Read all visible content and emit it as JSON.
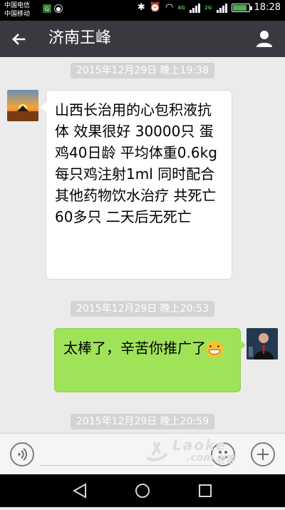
{
  "status": {
    "carrier1": "中国电信",
    "carrier2": "中国移动",
    "net1": "4G",
    "net2": "2G",
    "time": "18:28"
  },
  "appbar": {
    "title": "济南王峰"
  },
  "messages": [
    {
      "timestamp": "2015年12月29日 晚上19:38",
      "sender": "left",
      "text": "山西长治用的心包积液抗体 效果很好 30000只 蛋鸡40日龄 平均体重0.6kg 每只鸡注射1ml 同时配合其他药物饮水治疗 共死亡60多只 二天后无死亡"
    },
    {
      "timestamp": "2015年12月29日 晚上20:53",
      "sender": "right",
      "text": "太棒了，辛苦你推广了"
    },
    {
      "timestamp": "2015年12月29日 晚上20:59"
    }
  ],
  "watermark": {
    "brand": "Laoke",
    "domain": ".com",
    "suffix": "老客"
  },
  "icons": {
    "back": "back-arrow-icon",
    "profile": "person-icon",
    "voice": "voice-icon",
    "emoji": "emoji-icon",
    "plus": "plus-icon"
  }
}
